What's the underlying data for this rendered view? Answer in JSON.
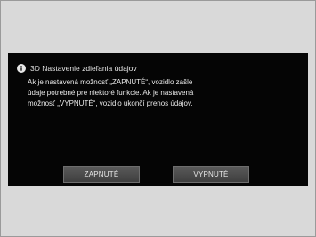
{
  "dialog": {
    "title": "3D Nastavenie zdieľania údajov",
    "message_lines": [
      "Ak je nastavená možnosť „ZAPNUTÉ“, vozidlo zašle",
      "údaje potrebné pre niektoré funkcie. Ak je nastavená",
      "možnosť „VYPNUTÉ“, vozidlo ukončí prenos údajov."
    ],
    "icon": "info-icon",
    "buttons": {
      "on_label": "ZAPNUTÉ",
      "off_label": "VYPNUTÉ"
    }
  },
  "colors": {
    "screen_background": "#050505",
    "outer_background": "#d9d9d9",
    "button": "#4a4a4a",
    "text": "#e9e9e9"
  }
}
